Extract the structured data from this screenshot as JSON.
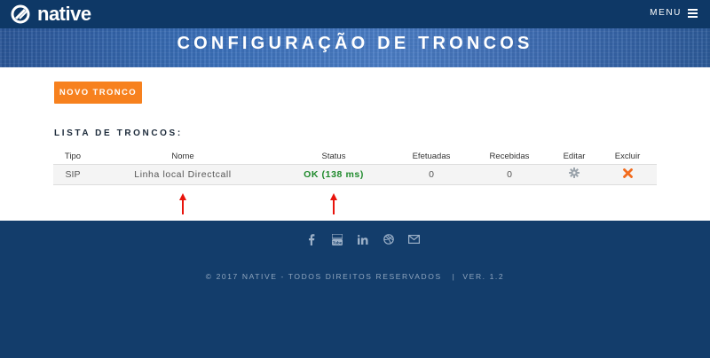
{
  "header": {
    "logo_text": "native",
    "menu_label": "MENU"
  },
  "banner": {
    "title": "CONFIGURAÇÃO DE TRONCOS"
  },
  "main": {
    "new_button_label": "NOVO TRONCO",
    "list_title": "LISTA DE TRONCOS:",
    "columns": [
      "Tipo",
      "Nome",
      "Status",
      "Efetuadas",
      "Recebidas",
      "Editar",
      "Excluir"
    ],
    "rows": [
      {
        "tipo": "SIP",
        "nome": "Linha local Directcall",
        "status": "OK (138 ms)",
        "efetuadas": "0",
        "recebidas": "0",
        "edit_icon": "gear-icon",
        "delete_icon": "close-icon"
      }
    ],
    "status_color": "#1f8a2c",
    "annotation_color": "#e8140c"
  },
  "footer": {
    "social_icons": [
      "facebook-icon",
      "youtube-icon",
      "linkedin-icon",
      "dribbble-icon",
      "mail-icon"
    ],
    "copyright": "© 2017 NATIVE - TODOS DIREITOS RESERVADOS",
    "version": "VER. 1.2"
  },
  "colors": {
    "nav": "#0e3866",
    "footer": "#133d6b",
    "accent": "#f7811e"
  }
}
